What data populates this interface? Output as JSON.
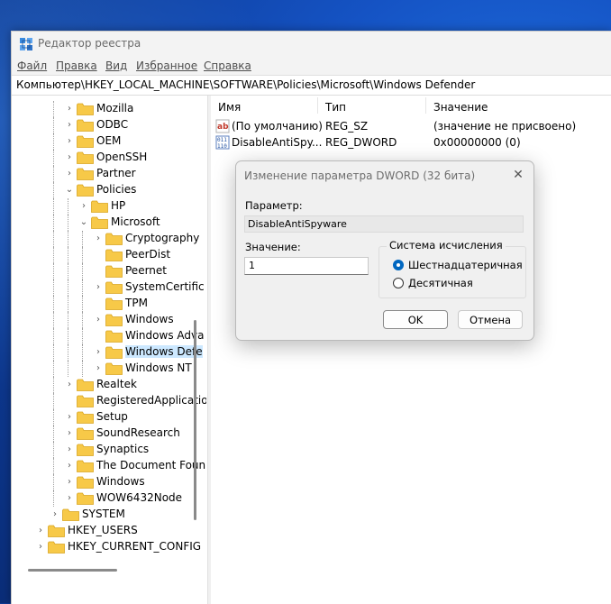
{
  "window": {
    "title": "Редактор реестра",
    "menu": [
      "Файл",
      "Правка",
      "Вид",
      "Избранное",
      "Справка"
    ],
    "address": "Компьютер\\HKEY_LOCAL_MACHINE\\SOFTWARE\\Policies\\Microsoft\\Windows Defender"
  },
  "tree": [
    {
      "label": "Mozilla",
      "expand": "collapsed"
    },
    {
      "label": "ODBC",
      "expand": "collapsed"
    },
    {
      "label": "OEM",
      "expand": "collapsed"
    },
    {
      "label": "OpenSSH",
      "expand": "collapsed"
    },
    {
      "label": "Partner",
      "expand": "collapsed"
    },
    {
      "label": "Policies",
      "expand": "expanded"
    },
    {
      "label": "HP",
      "expand": "collapsed"
    },
    {
      "label": "Microsoft",
      "expand": "expanded"
    },
    {
      "label": "Cryptography",
      "expand": "collapsed"
    },
    {
      "label": "PeerDist",
      "expand": "none"
    },
    {
      "label": "Peernet",
      "expand": "none"
    },
    {
      "label": "SystemCertific",
      "expand": "collapsed"
    },
    {
      "label": "TPM",
      "expand": "none"
    },
    {
      "label": "Windows",
      "expand": "collapsed"
    },
    {
      "label": "Windows Adva",
      "expand": "none"
    },
    {
      "label": "Windows Defe",
      "expand": "collapsed",
      "selected": true
    },
    {
      "label": "Windows NT",
      "expand": "collapsed"
    },
    {
      "label": "Realtek",
      "expand": "collapsed"
    },
    {
      "label": "RegisteredApplicatio",
      "expand": "none"
    },
    {
      "label": "Setup",
      "expand": "collapsed"
    },
    {
      "label": "SoundResearch",
      "expand": "collapsed"
    },
    {
      "label": "Synaptics",
      "expand": "collapsed"
    },
    {
      "label": "The Document Foun",
      "expand": "collapsed"
    },
    {
      "label": "Windows",
      "expand": "collapsed"
    },
    {
      "label": "WOW6432Node",
      "expand": "collapsed"
    },
    {
      "label": "SYSTEM",
      "expand": "collapsed"
    },
    {
      "label": "HKEY_USERS",
      "expand": "collapsed"
    },
    {
      "label": "HKEY_CURRENT_CONFIG",
      "expand": "collapsed"
    }
  ],
  "list": {
    "columns": [
      "Имя",
      "Тип",
      "Значение"
    ],
    "rows": [
      {
        "name": "(По умолчанию)",
        "type": "REG_SZ",
        "value": "(значение не присвоено)",
        "icon": "string-value-icon"
      },
      {
        "name": "DisableAntiSpy...",
        "type": "REG_DWORD",
        "value": "0x00000000 (0)",
        "icon": "binary-value-icon"
      }
    ]
  },
  "dialog": {
    "title": "Изменение параметра DWORD (32 бита)",
    "param_label": "Параметр:",
    "param_value": "DisableAntiSpyware",
    "value_label": "Значение:",
    "value": "1",
    "base_group": "Система исчисления",
    "base_hex": "Шестнадцатеричная",
    "base_dec": "Десятичная",
    "base_selected": "hex",
    "ok": "OK",
    "cancel": "Отмена"
  },
  "colors": {
    "selection": "#cce8ff",
    "folder": "#f7c948",
    "accent": "#0067c0"
  }
}
